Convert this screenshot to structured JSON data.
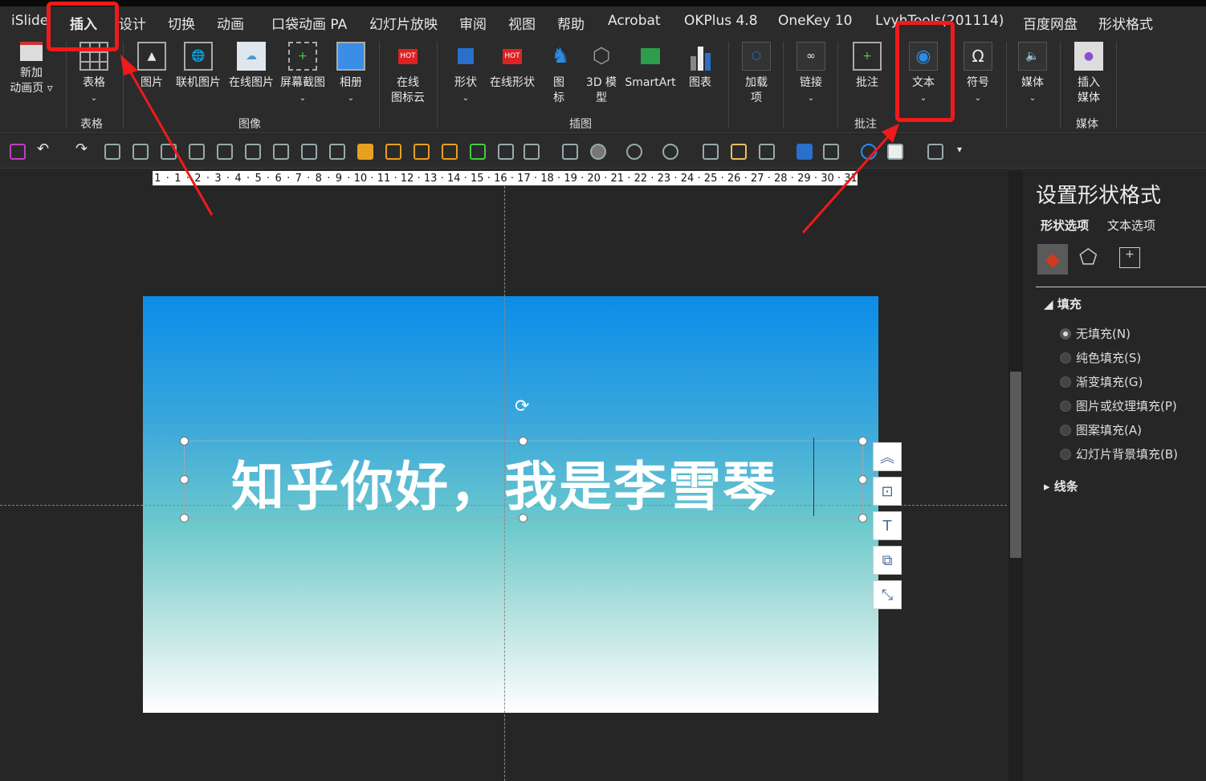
{
  "tabs": [
    "iSlide",
    "插入",
    "设计",
    "切换",
    "动画",
    "口袋动画 PA",
    "幻灯片放映",
    "审阅",
    "视图",
    "帮助",
    "Acrobat",
    "OKPlus 4.8",
    "OneKey 10",
    "LvyhTools(201114)",
    "百度网盘",
    "形状格式"
  ],
  "active_tab": "插入",
  "ribbon": {
    "buttons": [
      "新加\n动画页 ▿",
      "表格",
      "图片",
      "联机图片",
      "在线图片",
      "屏幕截图",
      "相册",
      "在线\n图标云",
      "形状",
      "在线形状",
      "图\n标",
      "3D 模\n型",
      "SmartArt",
      "图表",
      "加载\n项",
      "链接",
      "批注",
      "文本",
      "符号",
      "媒体",
      "插入\n媒体"
    ],
    "groups": [
      "表格",
      "图像",
      "插图",
      "批注",
      "媒体"
    ],
    "hot_badge": "HOT"
  },
  "ruler": [
    "1",
    "·",
    "1",
    "·",
    "2",
    "·",
    "3",
    "·",
    "4",
    "·",
    "5",
    "·",
    "6",
    "·",
    "7",
    "·",
    "8",
    "·",
    "9",
    "·",
    "10",
    "·",
    "11",
    "·",
    "12",
    "·",
    "13",
    "·",
    "14",
    "·",
    "15",
    "·",
    "16",
    "·",
    "17",
    "·",
    "18",
    "·",
    "19",
    "·",
    "20",
    "·",
    "21",
    "·",
    "22",
    "·",
    "23",
    "·",
    "24",
    "·",
    "25",
    "·",
    "26",
    "·",
    "27",
    "·",
    "28",
    "·",
    "29",
    "·",
    "30",
    "·",
    "31"
  ],
  "slide": {
    "text": "知乎你好，我是李雪琴"
  },
  "panel": {
    "title": "设置形状格式",
    "tabs": [
      "形状选项",
      "文本选项"
    ],
    "fill_section": "填充",
    "fill_options": [
      "无填充(N)",
      "纯色填充(S)",
      "渐变填充(G)",
      "图片或纹理填充(P)",
      "图案填充(A)",
      "幻灯片背景填充(B)"
    ],
    "selected_fill": "无填充(N)",
    "line_section": "线条"
  },
  "colors": {
    "annotation": "#f01a1a",
    "slide_top": "#0a8ce8",
    "slide_bottom": "#ffffff"
  }
}
